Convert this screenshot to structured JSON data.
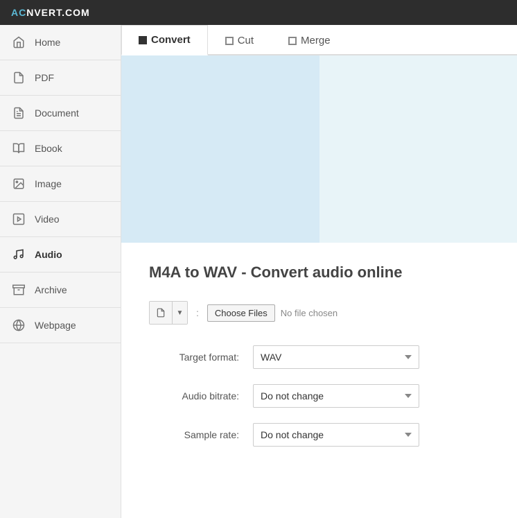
{
  "topnav": {
    "logo_text": "AC",
    "logo_arrow": "⟳",
    "logo_rest": "NVERT.COM"
  },
  "sidebar": {
    "items": [
      {
        "id": "home",
        "label": "Home",
        "icon": "🏠"
      },
      {
        "id": "pdf",
        "label": "PDF",
        "icon": "📄"
      },
      {
        "id": "document",
        "label": "Document",
        "icon": "📝"
      },
      {
        "id": "ebook",
        "label": "Ebook",
        "icon": "📖"
      },
      {
        "id": "image",
        "label": "Image",
        "icon": "🖼"
      },
      {
        "id": "video",
        "label": "Video",
        "icon": "🎬"
      },
      {
        "id": "audio",
        "label": "Audio",
        "icon": "🎵"
      },
      {
        "id": "archive",
        "label": "Archive",
        "icon": "📦"
      },
      {
        "id": "webpage",
        "label": "Webpage",
        "icon": "🌐"
      }
    ]
  },
  "tabs": [
    {
      "id": "convert",
      "label": "Convert",
      "active": true
    },
    {
      "id": "cut",
      "label": "Cut",
      "active": false
    },
    {
      "id": "merge",
      "label": "Merge",
      "active": false
    }
  ],
  "page": {
    "title": "M4A to WAV - Convert audio online",
    "file_input": {
      "choose_files_label": "Choose Files",
      "no_file_text": "No file chosen"
    },
    "form": {
      "target_format_label": "Target format:",
      "target_format_value": "WAV",
      "audio_bitrate_label": "Audio bitrate:",
      "audio_bitrate_value": "Do not change",
      "sample_rate_label": "Sample rate:",
      "sample_rate_value": "Do not change"
    }
  }
}
